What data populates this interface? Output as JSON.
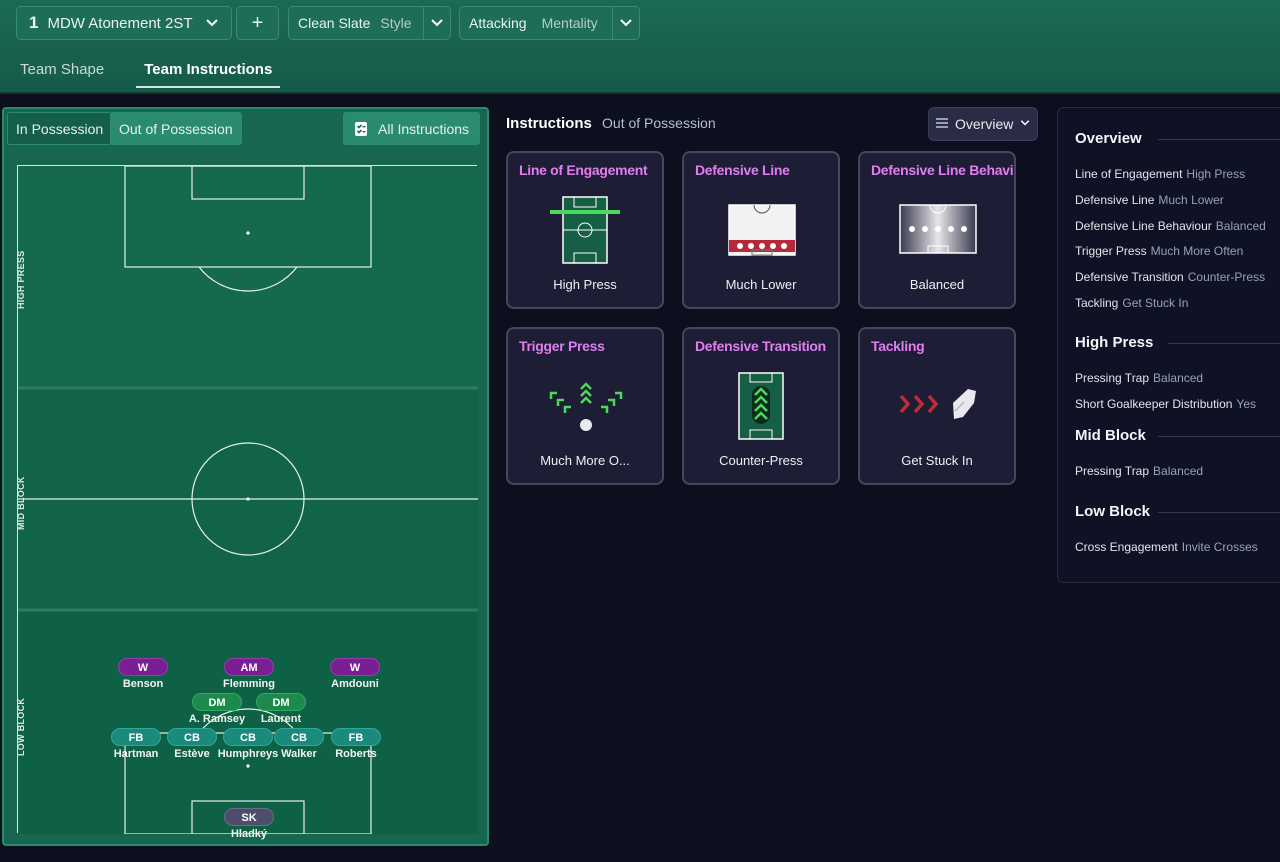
{
  "topbar": {
    "tactic_number": "1",
    "tactic_name": "MDW Atonement 2ST",
    "add_label": "+",
    "style_value": "Clean Slate",
    "style_label": "Style",
    "mentality_value": "Attacking",
    "mentality_label": "Mentality",
    "tabs": [
      {
        "label": "Team Shape"
      },
      {
        "label": "Team Instructions"
      }
    ]
  },
  "left": {
    "toggles": [
      {
        "label": "In Possession"
      },
      {
        "label": "Out of Possession"
      }
    ],
    "all_instructions_label": "All Instructions",
    "zones": [
      {
        "label": "HIGH PRESS"
      },
      {
        "label": "MID BLOCK"
      },
      {
        "label": "LOW BLOCK"
      }
    ],
    "players": [
      {
        "pos": "W",
        "name": "Benson",
        "color": "#7a1f93"
      },
      {
        "pos": "AM",
        "name": "Flemming",
        "color": "#7a1f93"
      },
      {
        "pos": "W",
        "name": "Amdouni",
        "color": "#7a1f93"
      },
      {
        "pos": "DM",
        "name": "A. Ramsey",
        "color": "#1b8a4b"
      },
      {
        "pos": "DM",
        "name": "Laurent",
        "color": "#1b8a4b"
      },
      {
        "pos": "FB",
        "name": "Hartman",
        "color": "#1a8a7c"
      },
      {
        "pos": "CB",
        "name": "Estève",
        "color": "#1a8a7c"
      },
      {
        "pos": "CB",
        "name": "Humphreys",
        "color": "#1a8a7c"
      },
      {
        "pos": "CB",
        "name": "Walker",
        "color": "#1a8a7c"
      },
      {
        "pos": "FB",
        "name": "Roberts",
        "color": "#1a8a7c"
      },
      {
        "pos": "SK",
        "name": "Hladký",
        "color": "#4c4e6b"
      }
    ]
  },
  "middle": {
    "title": "Instructions",
    "subtitle": "Out of Possession",
    "overview_label": "Overview",
    "cards": [
      {
        "title": "Line of Engagement",
        "value": "High Press"
      },
      {
        "title": "Defensive Line",
        "value": "Much Lower"
      },
      {
        "title": "Defensive Line Behavio",
        "value": "Balanced"
      },
      {
        "title": "Trigger Press",
        "value": "Much More O..."
      },
      {
        "title": "Defensive Transition",
        "value": "Counter-Press"
      },
      {
        "title": "Tackling",
        "value": "Get Stuck In"
      }
    ]
  },
  "right": {
    "sections": [
      {
        "title": "Overview",
        "items": [
          {
            "label": "Line of Engagement",
            "value": "High Press"
          },
          {
            "label": "Defensive Line",
            "value": "Much Lower"
          },
          {
            "label": "Defensive Line Behaviour",
            "value": "Balanced"
          },
          {
            "label": "Trigger Press",
            "value": "Much More Often"
          },
          {
            "label": "Defensive Transition",
            "value": "Counter-Press"
          },
          {
            "label": "Tackling",
            "value": "Get Stuck In"
          }
        ]
      },
      {
        "title": "High Press",
        "items": [
          {
            "label": "Pressing Trap",
            "value": "Balanced"
          },
          {
            "label": "Short Goalkeeper Distribution",
            "value": "Yes"
          }
        ]
      },
      {
        "title": "Mid Block",
        "items": [
          {
            "label": "Pressing Trap",
            "value": "Balanced"
          }
        ]
      },
      {
        "title": "Low Block",
        "items": [
          {
            "label": "Cross Engagement",
            "value": "Invite Crosses"
          }
        ]
      }
    ]
  },
  "colors": {
    "accent_green": "#1b6a55",
    "card_title": "#e07ef0",
    "background": "#0b0f1e"
  }
}
